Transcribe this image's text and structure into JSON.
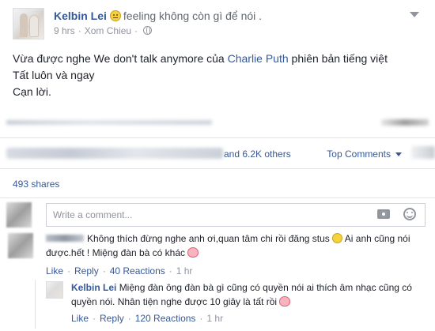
{
  "post": {
    "author": "Kelbin Lei",
    "feeling": "feeling không còn gì để nói .",
    "time": "9 hrs",
    "location": "Xom Chieu",
    "separator": "·",
    "body": {
      "line1_before": "Vừa được nghe We don't talk anymore của ",
      "line1_link": "Charlie Puth",
      "line1_after": " phiên bản tiếng việt",
      "line2": "Tất luôn và ngay",
      "line3": "Cạn lời."
    }
  },
  "reactions": {
    "others": "and 6.2K others",
    "sort_label": "Top Comments",
    "shares": "493 shares"
  },
  "composer": {
    "placeholder": "Write a comment..."
  },
  "comments": [
    {
      "text_part1": "Không thích đừng nghe anh ơi,quan tâm chi rồi đăng stus",
      "text_part2": "Ai anh cũng nói được.hết ! Miệng đàn bà có khác",
      "like": "Like",
      "reply": "Reply",
      "reactions": "40 Reactions",
      "time": "1 hr"
    },
    {
      "author": "Kelbin Lei",
      "text": "Miệng đàn ông đàn bà gì cũng có quyền nói ai thích âm nhạc cũng có quyền nói. Nhân tiện nghe được 10 giây là tất rồi",
      "like": "Like",
      "reply": "Reply",
      "reactions": "120 Reactions",
      "time": "1 hr"
    }
  ],
  "colors": {
    "link": "#365899",
    "muted": "#90949c",
    "text": "#1d2129",
    "border": "#e5e5e5"
  }
}
